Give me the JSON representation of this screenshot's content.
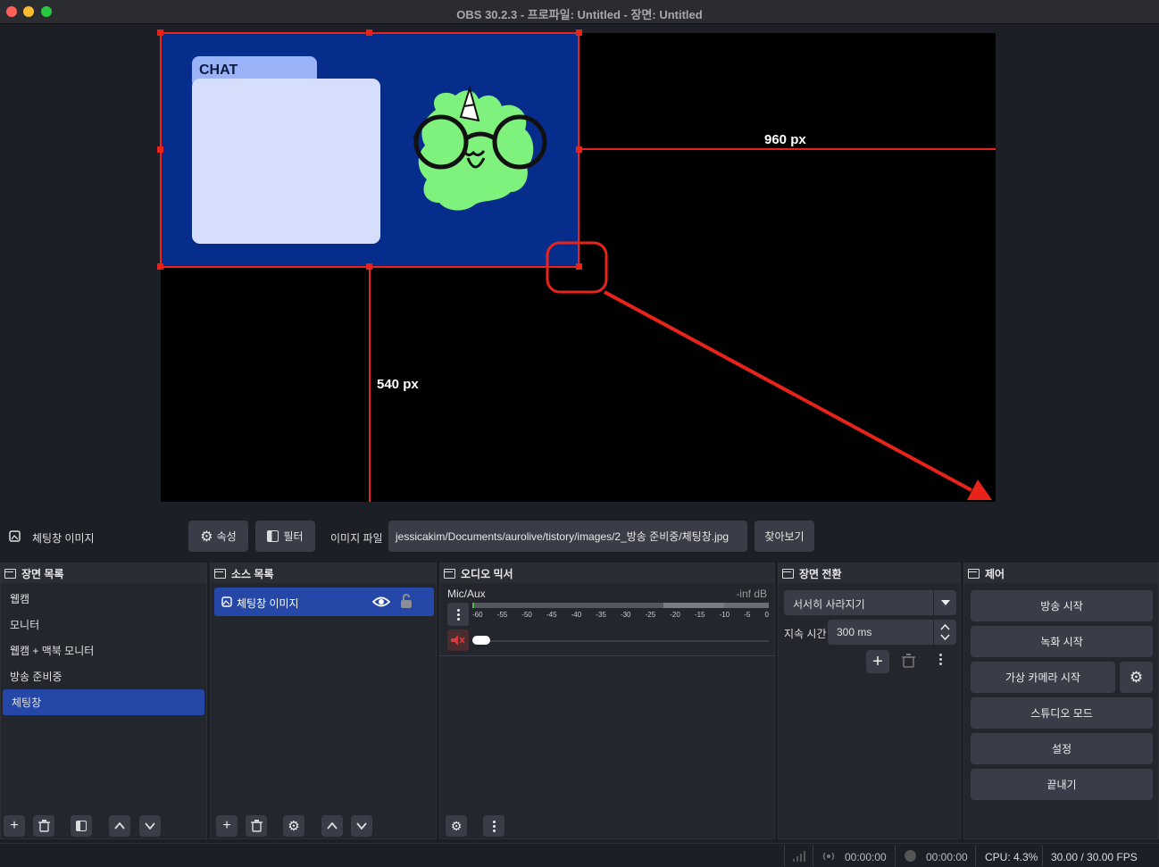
{
  "window": {
    "title": "OBS 30.2.3 - 프로파일: Untitled - 장면: Untitled"
  },
  "preview": {
    "chat_label": "CHAT",
    "width_label": "960 px",
    "height_label": "540 px"
  },
  "source_bar": {
    "source_name": "체팅창 이미지",
    "properties_label": "속성",
    "filters_label": "필터",
    "image_file_label": "이미지 파일",
    "file_path": "jessicakim/Documents/aurolive/tistory/images/2_방송 준비중/체팅창.jpg",
    "browse_label": "찾아보기"
  },
  "scenes": {
    "title": "장면 목록",
    "items": [
      "웹캠",
      "모니터",
      "웹캠 + 맥북 모니터",
      "방송 준비중",
      "체팅창"
    ],
    "selected": "체팅창"
  },
  "sources": {
    "title": "소스 목록",
    "items": [
      "체팅창 이미지"
    ]
  },
  "mixer": {
    "title": "오디오 믹서",
    "channel": "Mic/Aux",
    "level": "-inf dB",
    "ticks": [
      "-60",
      "-55",
      "-50",
      "-45",
      "-40",
      "-35",
      "-30",
      "-25",
      "-20",
      "-15",
      "-10",
      "-5",
      "0"
    ]
  },
  "transitions": {
    "title": "장면 전환",
    "selected": "서서히 사라지기",
    "duration_label": "지속 시간",
    "duration_value": "300 ms"
  },
  "controls": {
    "title": "제어",
    "start_stream": "방송 시작",
    "start_record": "녹화 시작",
    "virtual_cam": "가상 카메라 시작",
    "studio_mode": "스튜디오 모드",
    "settings": "설정",
    "exit": "끝내기"
  },
  "status": {
    "stream_time": "00:00:00",
    "record_time": "00:00:00",
    "cpu": "CPU: 4.3%",
    "fps": "30.00 / 30.00 FPS"
  },
  "colors": {
    "accent": "#2547a8",
    "selection_red": "#e8231a",
    "canvas_blue": "#062c8c",
    "mascot_green": "#7ef27c"
  }
}
